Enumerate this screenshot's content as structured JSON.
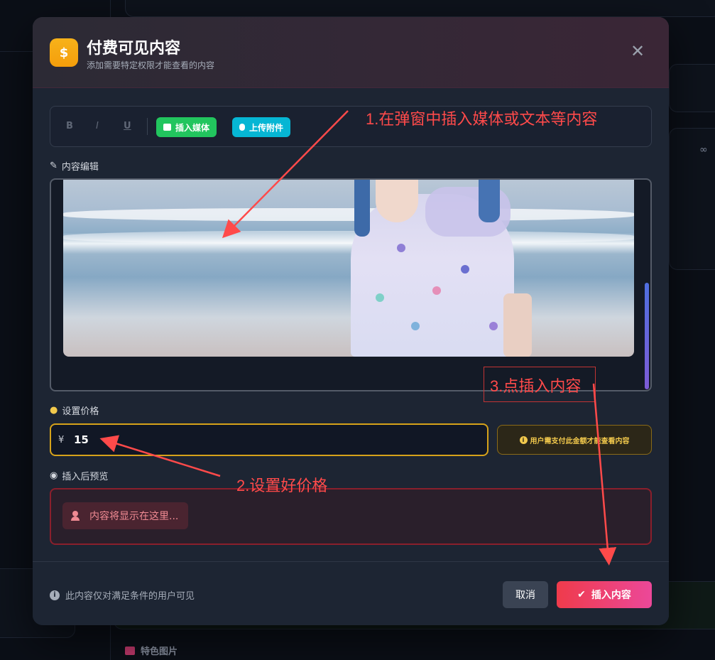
{
  "modal": {
    "icon_glyph": "$",
    "title": "付费可见内容",
    "subtitle": "添加需要特定权限才能查看的内容",
    "close_glyph": "✕"
  },
  "toolbar": {
    "bold": "B",
    "italic": "I",
    "underline": "U",
    "insert_media": "插入媒体",
    "upload_attachment": "上传附件"
  },
  "editor": {
    "label": "内容编辑"
  },
  "price": {
    "label": "设置价格",
    "currency": "¥",
    "value": "15",
    "hint": "用户需支付此金额才能查看内容"
  },
  "preview": {
    "label": "插入后预览",
    "placeholder": "内容将显示在这里..."
  },
  "footer": {
    "note": "此内容仅对满足条件的用户可见",
    "cancel": "取消",
    "insert": "插入内容"
  },
  "background": {
    "featured_image_label": "特色图片"
  },
  "annotations": {
    "step1": "1.在弹窗中插入媒体或文本等内容",
    "step2": "2.设置好价格",
    "step3": "3.点插入内容"
  },
  "colors": {
    "accent_red": "#ef3b4b",
    "accent_pink": "#ec4899",
    "price_border": "#d6a21a",
    "media_green": "#22c55e",
    "attach_cyan": "#06b6d4",
    "annotation_red": "#ff4a4a"
  },
  "icons": {
    "header": "dollar-icon",
    "close": "close-icon",
    "media": "image-icon",
    "attach": "paperclip-icon",
    "edit": "edit-icon",
    "price": "coins-icon",
    "preview": "eye-icon",
    "lock_user": "user-lock-icon",
    "info": "info-icon",
    "check": "check-icon",
    "link": "link-icon"
  }
}
